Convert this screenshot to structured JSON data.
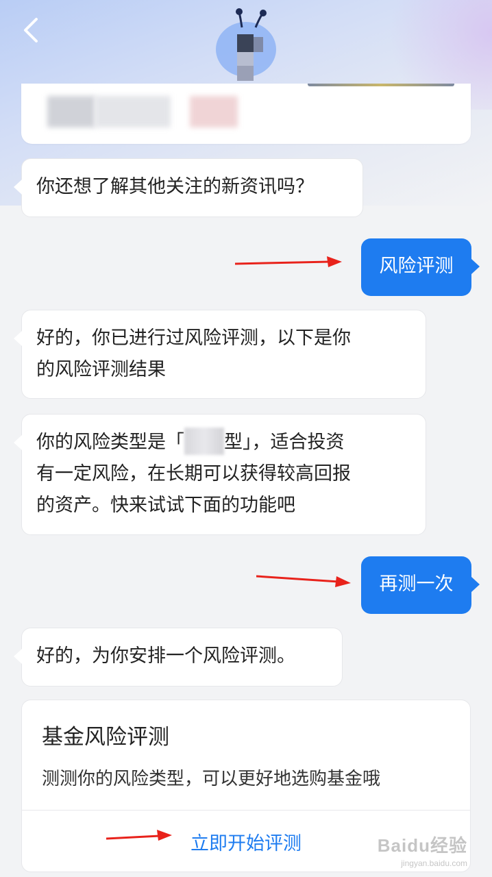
{
  "header": {
    "back_icon": "chevron-left-icon",
    "avatar": "assistant-avatar"
  },
  "messages": [
    {
      "id": "bot1",
      "role": "bot",
      "text": "你还想了解其他关注的新资讯吗？"
    },
    {
      "id": "user1",
      "role": "user",
      "text": "风险评测"
    },
    {
      "id": "bot2",
      "role": "bot",
      "lines": [
        "好的，你已进行过风险评测，以下是你",
        "的风险评测结果"
      ]
    },
    {
      "id": "bot3",
      "role": "bot",
      "line1_prefix": "你的风险类型是「",
      "line1_suffix": "型」，适合投资",
      "lines": [
        "有一定风险，在长期可以获得较高回报",
        "的资产。快来试试下面的功能吧"
      ]
    },
    {
      "id": "user2",
      "role": "user",
      "text": "再测一次"
    },
    {
      "id": "bot4",
      "role": "bot",
      "text": "好的，为你安排一个风险评测。"
    }
  ],
  "eval_card": {
    "title": "基金风险评测",
    "description": "测测你的风险类型，可以更好地选购基金哦",
    "action_label": "立即开始评测"
  },
  "watermark": {
    "main": "Baidu经验",
    "sub": "jingyan.baidu.com"
  },
  "colors": {
    "accent": "#1e7cf0",
    "annotation_arrow": "#e8221b"
  }
}
